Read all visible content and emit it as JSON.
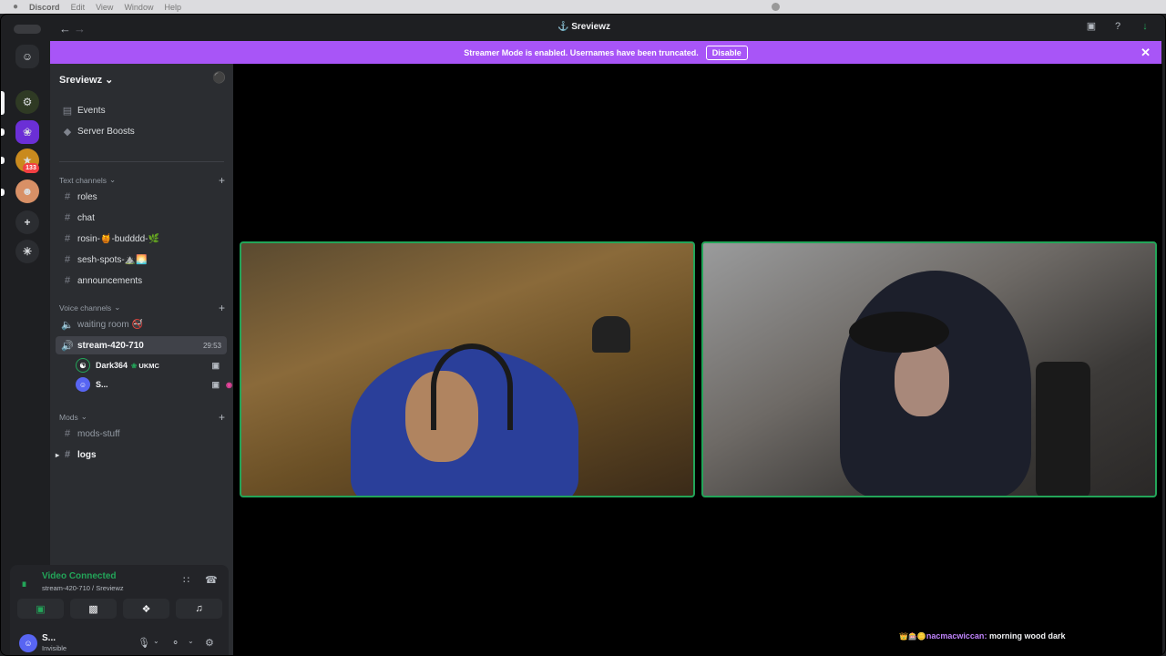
{
  "menubar": {
    "app": "Discord",
    "items": [
      "Edit",
      "View",
      "Window",
      "Help"
    ]
  },
  "window": {
    "title": "Sreviewz"
  },
  "banner": {
    "text": "Streamer Mode is enabled. Usernames have been truncated.",
    "disable_label": "Disable"
  },
  "server": {
    "name": "Sreviewz",
    "mention_badge": "133"
  },
  "sidebar": {
    "events": "Events",
    "boosts": "Server Boosts",
    "text_category": "Text channels",
    "text_channels": [
      "roles",
      "chat",
      "rosin-🍯-budddd-🌿",
      "sesh-spots-⛰️🌅",
      "announcements"
    ],
    "voice_category": "Voice channels",
    "voice_channels": [
      {
        "name": "waiting room 🚭"
      },
      {
        "name": "stream-420-710",
        "timer": "29:53"
      }
    ],
    "voice_users": [
      {
        "name": "Dark364",
        "tag": "UKMC"
      },
      {
        "name": "S..."
      }
    ],
    "mods_category": "Mods",
    "mods_channels": [
      "mods-stuff",
      "logs"
    ]
  },
  "voice_panel": {
    "status": "Video Connected",
    "channel": "stream-420-710 / Sreviewz"
  },
  "user_panel": {
    "name": "S...",
    "status": "Invisible"
  },
  "chat": {
    "emoji": "👑🎰🪙",
    "author": "nacmacwiccan",
    "message": "morning wood dark"
  },
  "colors": {
    "accent": "#a855f7",
    "connected": "#23a559",
    "badge": "#f23f43"
  }
}
